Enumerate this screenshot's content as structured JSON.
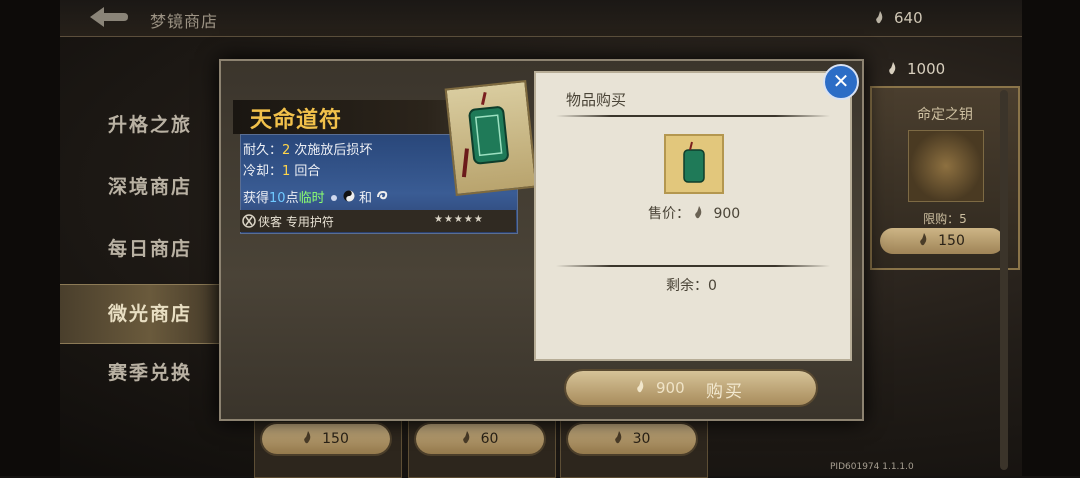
{
  "header": {
    "store_title": "梦镜商店",
    "currency_balance": "640"
  },
  "sidebar": {
    "items": [
      {
        "label": "升格之旅"
      },
      {
        "label": "深境商店"
      },
      {
        "label": "每日商店"
      },
      {
        "label": "微光商店",
        "active": true
      },
      {
        "label": "赛季兑换"
      }
    ]
  },
  "background": {
    "currency_balance": "1000",
    "card": {
      "name": "命定之钥",
      "limit": "限购：5",
      "price": "150"
    },
    "bottom_prices": [
      "150",
      "60",
      "30"
    ]
  },
  "item": {
    "name": "天命道符",
    "durability_label": "耐久：",
    "durability_value": "2",
    "durability_suffix": " 次施放后损坏",
    "cooldown_label": "冷却：",
    "cooldown_value": "1",
    "cooldown_suffix": " 回合",
    "gain_prefix": "获得",
    "gain_value": "10",
    "gain_unit": "点",
    "gain_type": "临时",
    "gain_and": "和",
    "footer_label": "侠客 专用护符",
    "rating": "★★★★★"
  },
  "purchase": {
    "title": "物品购买",
    "price_label": "售价：",
    "price_value": "900",
    "remaining_label": "剩余：",
    "remaining_value": "0",
    "buy_amount": "900",
    "buy_label": "购买",
    "close_symbol": "✕"
  },
  "footer": {
    "pid": "PID601974  1.1.1.0"
  },
  "colors": {
    "gold": "#f2c14b",
    "close_blue": "#2c6dc6",
    "highlight_green": "#8bff70"
  }
}
